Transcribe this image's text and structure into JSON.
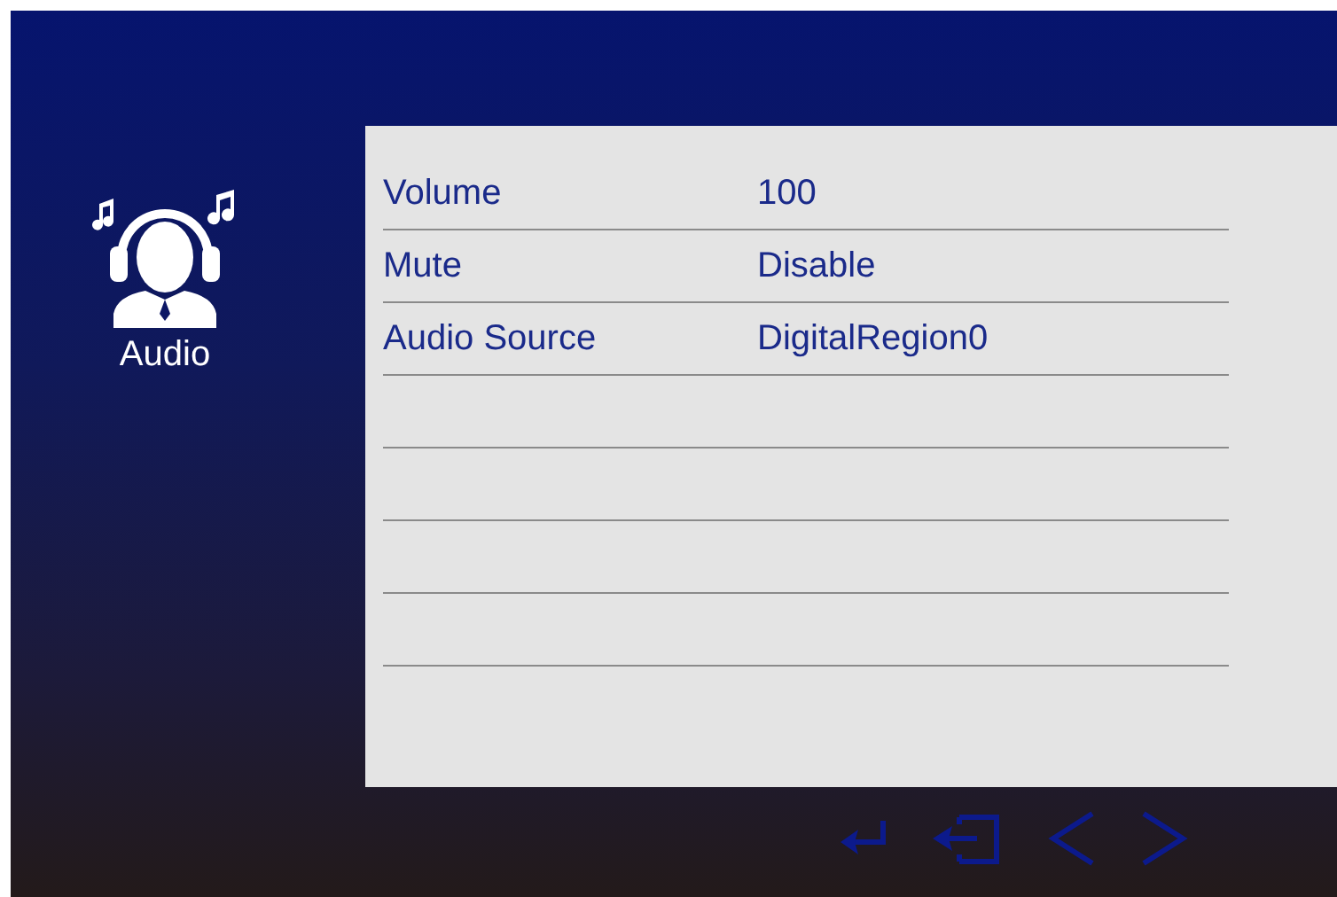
{
  "sidebar": {
    "items": [
      {
        "label": "Audio",
        "selected": true
      }
    ]
  },
  "settings": [
    {
      "label": "Volume",
      "value": "100"
    },
    {
      "label": "Mute",
      "value": "Disable"
    },
    {
      "label": "Audio Source",
      "value": "DigitalRegion0"
    }
  ]
}
